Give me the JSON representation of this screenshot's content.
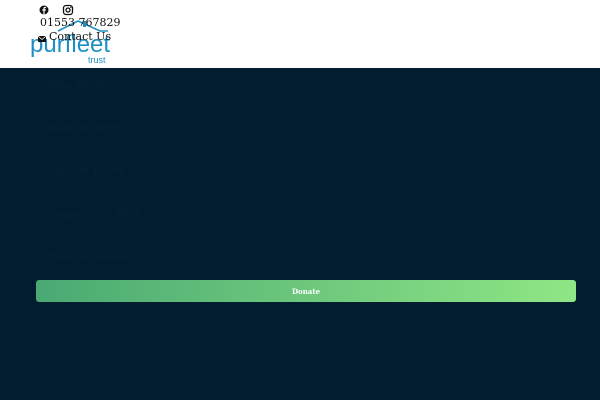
{
  "header": {
    "logo_word": "purfleet",
    "logo_sub": "trust",
    "social_icons": [
      "facebook-icon",
      "instagram-icon"
    ],
    "phone": "01553 767829",
    "contact_label": "Contact Us"
  },
  "nav": {
    "items": [
      {
        "label": "Who We Are"
      },
      {
        "label": "How We Help"
      },
      {
        "label": "Purfleet Pantry"
      },
      {
        "label": "Support Our Work"
      },
      {
        "label": "News & Stories"
      }
    ]
  },
  "donate": {
    "label": "Donate"
  },
  "colors": {
    "background": "#011d2f",
    "header": "#ffffff",
    "logo_blue": "#1f8fc1",
    "donate_start": "#4aa973",
    "donate_end": "#8fe685"
  }
}
